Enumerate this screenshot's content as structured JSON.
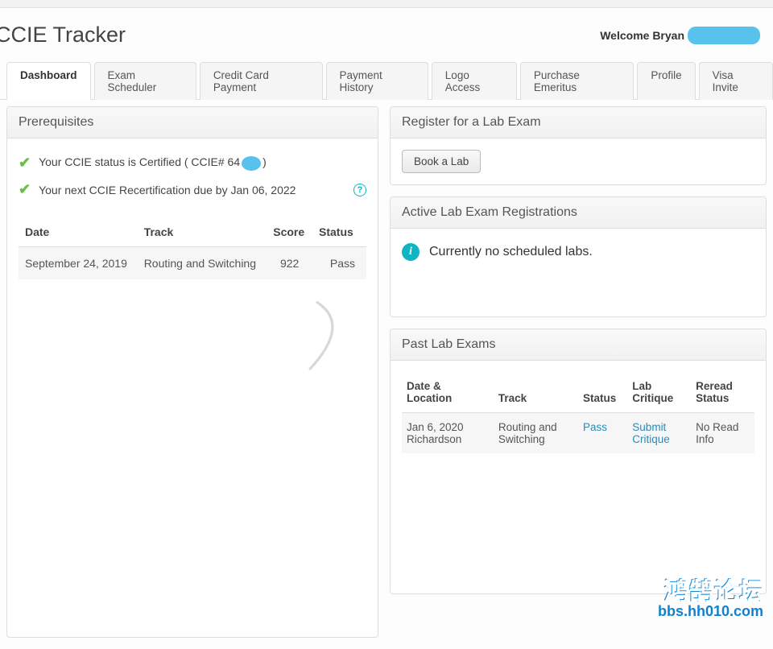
{
  "page": {
    "title": "CCIE Tracker",
    "welcome_prefix": "Welcome Bryan"
  },
  "tabs": [
    {
      "label": "Dashboard",
      "active": true
    },
    {
      "label": "Exam Scheduler",
      "active": false
    },
    {
      "label": "Credit Card Payment",
      "active": false
    },
    {
      "label": "Payment History",
      "active": false
    },
    {
      "label": "Logo Access",
      "active": false
    },
    {
      "label": "Purchase Emeritus",
      "active": false
    },
    {
      "label": "Profile",
      "active": false
    },
    {
      "label": "Visa Invite",
      "active": false
    }
  ],
  "prerequisites": {
    "title": "Prerequisites",
    "line1_prefix": "Your CCIE status is Certified ( CCIE# 64",
    "line1_suffix": ")",
    "line2": "Your next CCIE Recertification due by Jan 06, 2022",
    "table": {
      "headers": {
        "date": "Date",
        "track": "Track",
        "score": "Score",
        "status": "Status"
      },
      "rows": [
        {
          "date": "September 24, 2019",
          "track": "Routing and Switching",
          "score": "922",
          "status": "Pass"
        }
      ]
    }
  },
  "register": {
    "title": "Register for a Lab Exam",
    "button": "Book a Lab"
  },
  "active_reg": {
    "title": "Active Lab Exam Registrations",
    "empty": "Currently no scheduled labs."
  },
  "past": {
    "title": "Past Lab Exams",
    "headers": {
      "date_loc": "Date & Location",
      "track": "Track",
      "status": "Status",
      "critique": "Lab Critique",
      "reread": "Reread Status"
    },
    "rows": [
      {
        "date": "Jan 6, 2020",
        "location": "Richardson",
        "track": "Routing and Switching",
        "status": "Pass",
        "critique": "Submit Critique",
        "reread": "No Read Info"
      }
    ]
  },
  "watermark": {
    "cn": "鸿鹄论坛",
    "url": "bbs.hh010.com"
  }
}
